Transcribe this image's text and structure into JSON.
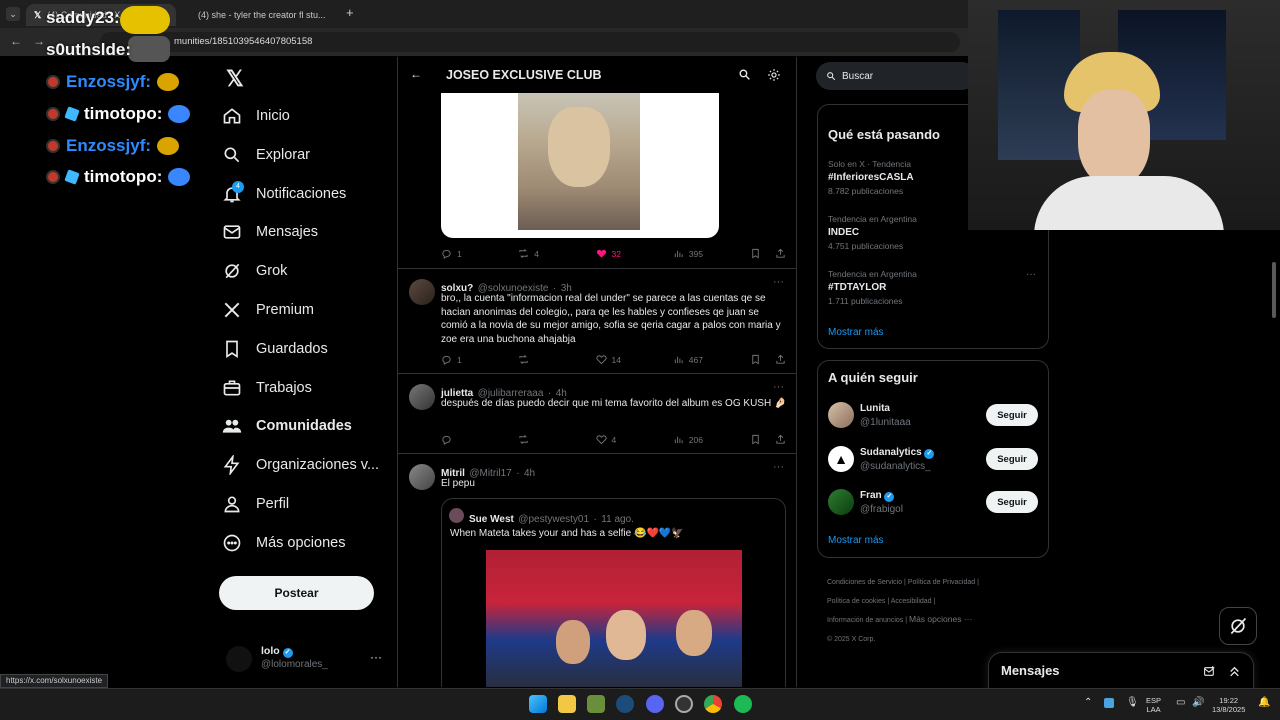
{
  "browser": {
    "tabs": [
      {
        "title": "(4) Comunidad / X",
        "icon": "x-logo-icon"
      },
      {
        "title": "(4) she - tyler the creator fl stu...",
        "icon": "youtube-icon"
      }
    ],
    "url": "munities/1851039546407805158",
    "status_url": "https://x.com/solxunoexiste"
  },
  "stream_chat": [
    {
      "user": "saddy23:",
      "color": "#f5f5f5"
    },
    {
      "user": "s0uthslde:",
      "color": "#f5f5f5"
    },
    {
      "user": "Enzossjyf:",
      "color": "#2e8bff"
    },
    {
      "user": "timotopo:",
      "color": "#ffffff"
    },
    {
      "user": "Enzossjyf:",
      "color": "#2e8bff"
    },
    {
      "user": "timotopo:",
      "color": "#ffffff"
    }
  ],
  "nav": {
    "items": [
      {
        "label": "Inicio",
        "icon": "home-icon"
      },
      {
        "label": "Explorar",
        "icon": "search-icon"
      },
      {
        "label": "Notificaciones",
        "icon": "bell-icon",
        "badge": "4"
      },
      {
        "label": "Mensajes",
        "icon": "mail-icon"
      },
      {
        "label": "Grok",
        "icon": "grok-icon"
      },
      {
        "label": "Premium",
        "icon": "x-logo-icon"
      },
      {
        "label": "Guardados",
        "icon": "bookmark-icon"
      },
      {
        "label": "Trabajos",
        "icon": "briefcase-icon"
      },
      {
        "label": "Comunidades",
        "icon": "people-icon"
      },
      {
        "label": "Organizaciones v...",
        "icon": "lightning-icon"
      },
      {
        "label": "Perfil",
        "icon": "person-icon"
      },
      {
        "label": "Más opciones",
        "icon": "more-circle-icon"
      }
    ],
    "post_label": "Postear",
    "account": {
      "name": "lolo",
      "handle": "@lolomorales_"
    }
  },
  "feed": {
    "header_title": "JOSEO EXCLUSIVE CLUB",
    "tweet0": {
      "replies": "1",
      "reposts": "4",
      "likes": "32",
      "views": "395"
    },
    "tweets": [
      {
        "name": "solxu?",
        "handle": "@solxunoexiste",
        "time": "3h",
        "text": "bro,, la cuenta \"informacion real del under\" se parece a las cuentas qe se hacian anonimas del colegio,, para qe les hables y confieses qe juan se comió a la novia de su mejor amigo, sofia se qeria cagar a palos con maria y zoe era una buchona ahajabja",
        "replies": "1",
        "reposts": "",
        "likes": "14",
        "views": "467"
      },
      {
        "name": "julietta",
        "handle": "@julibarreraaa",
        "time": "4h",
        "text": "después de días puedo decir que mi tema favorito del album es OG KUSH 🤌🏻",
        "replies": "",
        "reposts": "",
        "likes": "4",
        "views": "206"
      },
      {
        "name": "Mitril",
        "handle": "@Mitril17",
        "time": "4h",
        "text": "El pepu",
        "quote": {
          "name": "Sue West",
          "handle": "@pestywesty01",
          "time": "11 ago.",
          "text": "When Mateta takes your and has a selfie 😂❤️💙🦅"
        }
      }
    ]
  },
  "right": {
    "search_placeholder": "Buscar",
    "trends_title": "Qué está pasando",
    "trends": [
      {
        "meta": "Solo en X · Tendencia",
        "name": "#InferioresCASLA",
        "count": "8.782 publicaciones"
      },
      {
        "meta": "Tendencia en Argentina",
        "name": "INDEC",
        "count": "4.751 publicaciones"
      },
      {
        "meta": "Tendencia en Argentina",
        "name": "#TDTAYLOR",
        "count": "1.711 publicaciones"
      }
    ],
    "show_more": "Mostrar más",
    "follow_title": "A quién seguir",
    "follow": [
      {
        "name": "Lunita",
        "handle": "@1lunitaaa",
        "verified": false
      },
      {
        "name": "Sudanalytics",
        "handle": "@sudanalytics_",
        "verified": true
      },
      {
        "name": "Fran",
        "handle": "@frabigol",
        "verified": true
      }
    ],
    "follow_label": "Seguir",
    "footer": [
      "Condiciones de Servicio",
      "Política de Privacidad",
      "Política de cookies",
      "Accesibilidad",
      "Información de anuncios",
      "Más opciones ···",
      "© 2025 X Corp."
    ],
    "messages_label": "Mensajes"
  },
  "taskbar": {
    "lang": "ESP",
    "layout": "LAA",
    "time": "19:22",
    "date": "13/8/2025"
  }
}
